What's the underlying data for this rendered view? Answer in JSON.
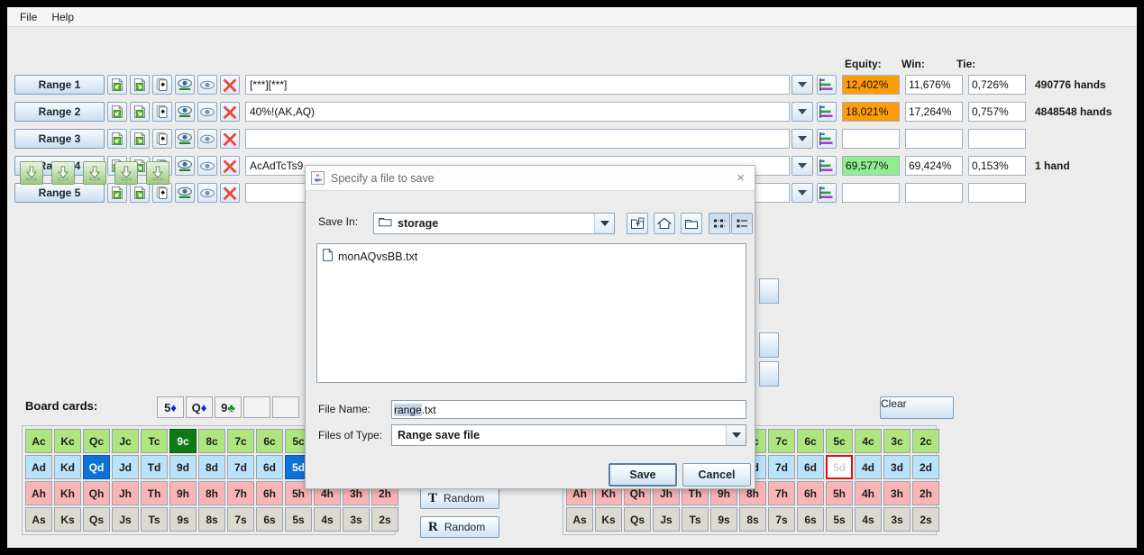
{
  "window": {
    "title": ""
  },
  "menubar": {
    "items": [
      {
        "label": "File"
      },
      {
        "label": "Help"
      }
    ]
  },
  "columns": {
    "equity": "Equity:",
    "win": "Win:",
    "tie": "Tie:"
  },
  "ranges": [
    {
      "button_label": "Range 1",
      "text": "[***][***]",
      "equity": "12,402%",
      "equity_color": "#ff9c0a",
      "win": "11,676%",
      "tie": "0,726%",
      "hands": "490776 hands"
    },
    {
      "button_label": "Range 2",
      "text": "40%!(AK,AQ)",
      "equity": "18,021%",
      "equity_color": "#ff9c0a",
      "win": "17,264%",
      "tie": "0,757%",
      "hands": "4848548 hands"
    },
    {
      "button_label": "Range 3",
      "text": "",
      "equity": "",
      "equity_color": "#ffffff",
      "win": "",
      "tie": "",
      "hands": ""
    },
    {
      "button_label": "Range 4",
      "text": "AcAdTcTs9",
      "equity": "69,577%",
      "equity_color": "#90ee90",
      "win": "69,424%",
      "tie": "0,153%",
      "hands": "1 hand"
    },
    {
      "button_label": "Range 5",
      "text": "",
      "equity": "",
      "equity_color": "#ffffff",
      "win": "",
      "tie": "",
      "hands": ""
    }
  ],
  "row_icons": [
    {
      "name": "load-range-icon"
    },
    {
      "name": "save-range-icon"
    },
    {
      "name": "cards-icon"
    },
    {
      "name": "eye-active-icon"
    },
    {
      "name": "eye-icon"
    },
    {
      "name": "delete-range-icon"
    }
  ],
  "board": {
    "label": "Board cards:",
    "slots": [
      {
        "rank": "5",
        "suit": "♦",
        "suit_class": "suit-d"
      },
      {
        "rank": "Q",
        "suit": "♦",
        "suit_class": "suit-d"
      },
      {
        "rank": "9",
        "suit": "♣",
        "suit_class": "suit-c"
      },
      {
        "rank": "",
        "suit": "",
        "suit_class": ""
      },
      {
        "rank": "",
        "suit": "",
        "suit_class": ""
      }
    ],
    "clear_label": "Clear"
  },
  "card_grid": {
    "ranks": [
      "A",
      "K",
      "Q",
      "J",
      "T",
      "9",
      "8",
      "7",
      "6",
      "5",
      "4",
      "3",
      "2"
    ],
    "suits": [
      "c",
      "d",
      "h",
      "s"
    ],
    "left_selected": [
      "9c",
      "Qd",
      "5d"
    ],
    "right_dead": [
      "5d"
    ]
  },
  "random_buttons": [
    {
      "letter": "T",
      "label": "Random"
    },
    {
      "letter": "R",
      "label": "Random"
    }
  ],
  "dialog": {
    "title": "Specify a file to save",
    "close_label": "×",
    "save_in_label": "Save In:",
    "save_in_value": "storage",
    "toolbar": [
      {
        "name": "up-one-level-icon"
      },
      {
        "name": "home-icon"
      },
      {
        "name": "new-folder-icon"
      },
      {
        "name": "details-view-icon"
      },
      {
        "name": "list-view-icon"
      }
    ],
    "files": [
      {
        "name": "monAQvsBB.txt"
      }
    ],
    "file_name_label": "File Name:",
    "file_name_selected": "range",
    "file_name_rest": ".txt",
    "file_type_label": "Files of Type:",
    "file_type_value": "Range save file",
    "save_label": "Save",
    "cancel_label": "Cancel"
  },
  "theme": {
    "accent": "#0b72d8",
    "equity_low": "#ff9c0a",
    "equity_high": "#90ee90",
    "dead_card_border": "#e01010"
  }
}
